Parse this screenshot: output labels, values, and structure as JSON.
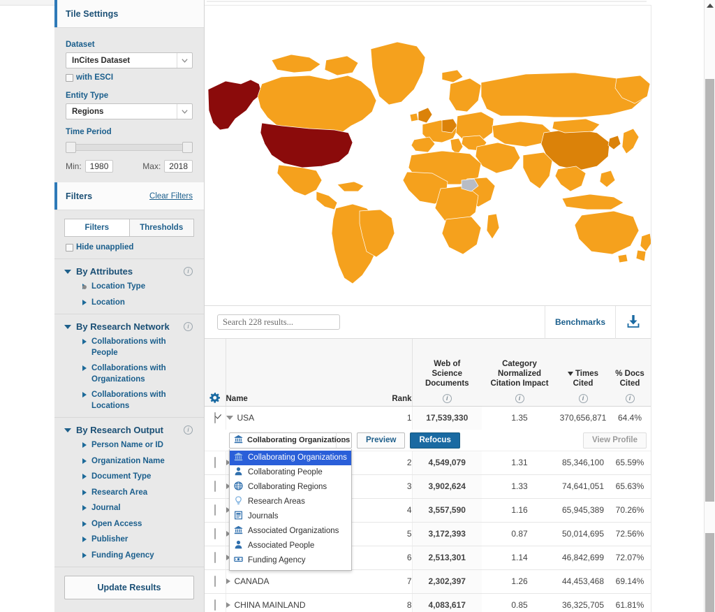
{
  "tile_settings": {
    "title": "Tile Settings",
    "dataset_label": "Dataset",
    "dataset_value": "InCites Dataset",
    "esci_label": "with ESCI",
    "entity_type_label": "Entity Type",
    "entity_type_value": "Regions",
    "time_period_label": "Time Period",
    "min_label": "Min:",
    "min_value": "1980",
    "max_label": "Max:",
    "max_value": "2018"
  },
  "filters": {
    "title": "Filters",
    "clear_label": "Clear Filters",
    "tab_filters": "Filters",
    "tab_thresholds": "Thresholds",
    "hide_unapplied": "Hide unapplied",
    "groups": [
      {
        "title": "By Attributes",
        "items": [
          {
            "label": "Location Type",
            "dot": true
          },
          {
            "label": "Location",
            "dot": false
          }
        ]
      },
      {
        "title": "By Research Network",
        "items": [
          {
            "label": "Collaborations with People",
            "dot": false
          },
          {
            "label": "Collaborations with Organizations",
            "dot": false
          },
          {
            "label": "Collaborations with Locations",
            "dot": false
          }
        ]
      },
      {
        "title": "By Research Output",
        "items": [
          {
            "label": "Person Name or ID",
            "dot": false
          },
          {
            "label": "Organization Name",
            "dot": false
          },
          {
            "label": "Document Type",
            "dot": false
          },
          {
            "label": "Research Area",
            "dot": false
          },
          {
            "label": "Journal",
            "dot": false
          },
          {
            "label": "Open Access",
            "dot": false
          },
          {
            "label": "Publisher",
            "dot": false
          },
          {
            "label": "Funding Agency",
            "dot": false
          }
        ]
      }
    ],
    "update_button": "Update Results"
  },
  "toolbar": {
    "search_placeholder": "Search 228 results...",
    "search_value": "",
    "benchmarks_label": "Benchmarks"
  },
  "table": {
    "columns": [
      {
        "key": "name",
        "label": "Name"
      },
      {
        "key": "rank",
        "label": "Rank"
      },
      {
        "key": "wos",
        "label": "Web of Science Documents",
        "lines": [
          "Web of",
          "Science",
          "Documents"
        ]
      },
      {
        "key": "cnci",
        "label": "Category Normalized Citation Impact",
        "lines": [
          "Category",
          "Normalized",
          "Citation Impact"
        ]
      },
      {
        "key": "times",
        "label": "Times Cited",
        "lines": [
          "Times",
          "Cited"
        ],
        "sorted": true
      },
      {
        "key": "docs",
        "label": "% Docs Cited",
        "lines": [
          "% Docs",
          "Cited"
        ]
      }
    ],
    "rows": [
      {
        "name": "USA",
        "rank": "1",
        "wos": "17,539,330",
        "cnci": "1.35",
        "times": "370,656,871",
        "docs": "64.4%",
        "checked": true,
        "expanded": true
      },
      {
        "name": "",
        "rank": "2",
        "wos": "4,549,079",
        "cnci": "1.31",
        "times": "85,346,100",
        "docs": "65.59%",
        "checked": false,
        "expanded": false
      },
      {
        "name": "",
        "rank": "3",
        "wos": "3,902,624",
        "cnci": "1.33",
        "times": "74,641,051",
        "docs": "65.63%",
        "checked": false,
        "expanded": false
      },
      {
        "name": "",
        "rank": "4",
        "wos": "3,557,590",
        "cnci": "1.16",
        "times": "65,945,389",
        "docs": "70.26%",
        "checked": false,
        "expanded": false
      },
      {
        "name": "",
        "rank": "5",
        "wos": "3,172,393",
        "cnci": "0.87",
        "times": "50,014,695",
        "docs": "72.56%",
        "checked": false,
        "expanded": false
      },
      {
        "name": "",
        "rank": "6",
        "wos": "2,513,301",
        "cnci": "1.14",
        "times": "46,842,699",
        "docs": "72.07%",
        "checked": false,
        "expanded": false
      },
      {
        "name": "CANADA",
        "rank": "7",
        "wos": "2,302,397",
        "cnci": "1.26",
        "times": "44,453,468",
        "docs": "69.14%",
        "checked": false,
        "expanded": false
      },
      {
        "name": "CHINA MAINLAND",
        "rank": "8",
        "wos": "4,083,617",
        "cnci": "0.85",
        "times": "36,325,705",
        "docs": "61.81%",
        "checked": false,
        "expanded": false
      }
    ]
  },
  "action_bar": {
    "dropdown_value": "Collaborating Organizations",
    "preview_label": "Preview",
    "refocus_label": "Refocus",
    "view_profile_label": "View Profile",
    "menu_items": [
      {
        "label": "Collaborating Organizations",
        "icon": "bank-icon",
        "selected": true
      },
      {
        "label": "Collaborating People",
        "icon": "person-icon",
        "selected": false
      },
      {
        "label": "Collaborating Regions",
        "icon": "globe-icon",
        "selected": false
      },
      {
        "label": "Research Areas",
        "icon": "bulb-icon",
        "selected": false
      },
      {
        "label": "Journals",
        "icon": "journal-icon",
        "selected": false
      },
      {
        "label": "Associated Organizations",
        "icon": "bank-icon",
        "selected": false
      },
      {
        "label": "Associated People",
        "icon": "person-icon",
        "selected": false
      },
      {
        "label": "Funding Agency",
        "icon": "money-icon",
        "selected": false
      }
    ]
  },
  "colors": {
    "accent_blue": "#1a6aa2",
    "link_blue": "#1a5e8c",
    "map_low": "#F5A11D",
    "map_mid": "#DB8209",
    "map_high": "#8B0B0B",
    "map_nodata": "#b8bcc4",
    "selected_blue": "#2a5fd9"
  }
}
